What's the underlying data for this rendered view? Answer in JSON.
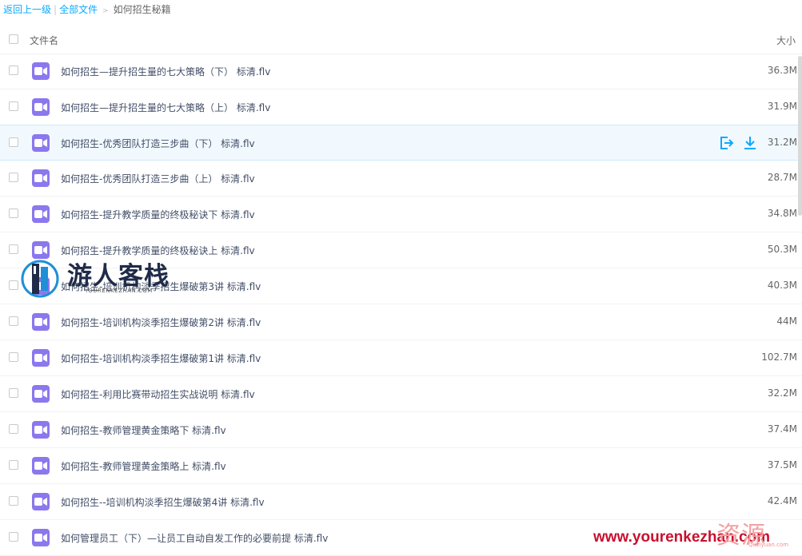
{
  "breadcrumb": {
    "back": "返回上一级",
    "all": "全部文件",
    "sep_bar": "|",
    "sep_arrow": ">",
    "current": "如何招生秘籍"
  },
  "header": {
    "name_col": "文件名",
    "size_col": "大小"
  },
  "files": [
    {
      "name": "如何招生—提升招生量的七大策略（下） 标清.flv",
      "size": "36.3M"
    },
    {
      "name": "如何招生—提升招生量的七大策略（上） 标清.flv",
      "size": "31.9M"
    },
    {
      "name": "如何招生-优秀团队打造三步曲（下） 标清.flv",
      "size": "31.2M"
    },
    {
      "name": "如何招生-优秀团队打造三步曲（上） 标清.flv",
      "size": "28.7M"
    },
    {
      "name": "如何招生-提升教学质量的终极秘诀下 标清.flv",
      "size": "34.8M"
    },
    {
      "name": "如何招生-提升教学质量的终极秘诀上 标清.flv",
      "size": "50.3M"
    },
    {
      "name": "如何招生-培训机构淡季招生爆破第3讲 标清.flv",
      "size": "40.3M"
    },
    {
      "name": "如何招生-培训机构淡季招生爆破第2讲 标清.flv",
      "size": "44M"
    },
    {
      "name": "如何招生-培训机构淡季招生爆破第1讲 标清.flv",
      "size": "102.7M"
    },
    {
      "name": "如何招生-利用比赛带动招生实战说明 标清.flv",
      "size": "32.2M"
    },
    {
      "name": "如何招生-教师管理黄金策略下 标清.flv",
      "size": "37.4M"
    },
    {
      "name": "如何招生-教师管理黄金策略上 标清.flv",
      "size": "37.5M"
    },
    {
      "name": "如何招生--培训机构淡季招生爆破第4讲 标清.flv",
      "size": "42.4M"
    },
    {
      "name": "如何管理员工（下）—让员工自动自发工作的必要前提 标清.flv",
      "size": ""
    }
  ],
  "hover_row_index": 2,
  "icons": {
    "file": "video-file-icon",
    "share": "share-icon",
    "download": "download-icon"
  },
  "colors": {
    "link": "#09aaff",
    "file_icon": "#8b78ee",
    "hover_bg": "#f1f9ff",
    "action": "#09aaff"
  },
  "logo": {
    "cn": "游人客栈",
    "en": "YOURENKEZHAN.COM"
  },
  "watermark": {
    "url": "www.yourenkezhan.com",
    "cn": "资源",
    "sub": "Quziyuan.com"
  }
}
